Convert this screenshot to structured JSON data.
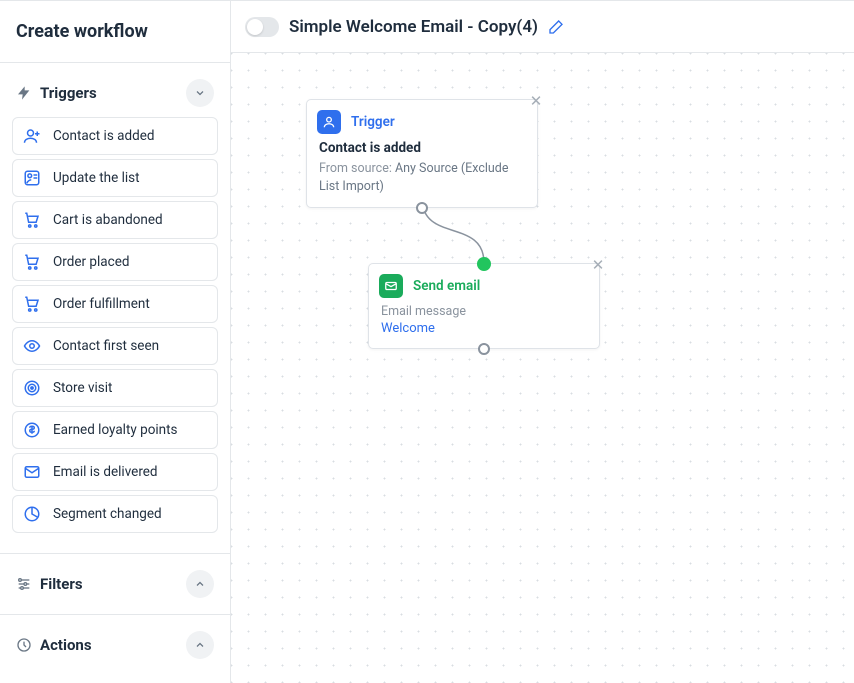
{
  "sidebar": {
    "title": "Create workflow",
    "sections": {
      "triggers": {
        "label": "Triggers",
        "items": [
          {
            "label": "Contact is added",
            "icon": "user-add-icon"
          },
          {
            "label": "Update the list",
            "icon": "list-update-icon"
          },
          {
            "label": "Cart is abandoned",
            "icon": "cart-icon"
          },
          {
            "label": "Order placed",
            "icon": "cart-check-icon"
          },
          {
            "label": "Order fulfillment",
            "icon": "cart-star-icon"
          },
          {
            "label": "Contact first seen",
            "icon": "eye-icon"
          },
          {
            "label": "Store visit",
            "icon": "target-icon"
          },
          {
            "label": "Earned loyalty points",
            "icon": "coin-icon"
          },
          {
            "label": "Email is delivered",
            "icon": "mail-icon"
          },
          {
            "label": "Segment changed",
            "icon": "pie-icon"
          }
        ]
      },
      "filters": {
        "label": "Filters"
      },
      "actions": {
        "label": "Actions"
      }
    }
  },
  "header": {
    "workflow_title": "Simple Welcome Email - Copy(4)"
  },
  "canvas": {
    "trigger_node": {
      "type_label": "Trigger",
      "title": "Contact is added",
      "source_prefix": "From source:",
      "source_value": "Any Source (Exclude List Import)"
    },
    "action_node": {
      "type_label": "Send email",
      "message_label": "Email message",
      "message_name": "Welcome"
    }
  }
}
